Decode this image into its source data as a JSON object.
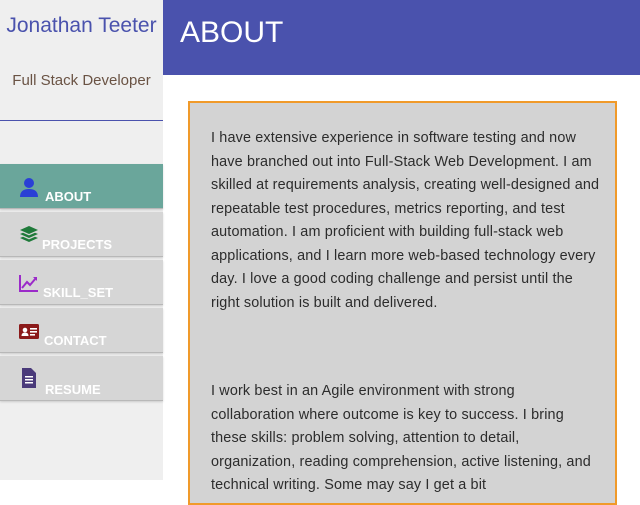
{
  "profile": {
    "name": "Jonathan Teeter",
    "title": "Full Stack Developer"
  },
  "nav": {
    "items": [
      {
        "label": "ABOUT",
        "icon": "user-icon",
        "active": true
      },
      {
        "label": "PROJECTS",
        "icon": "layers-icon",
        "active": false
      },
      {
        "label": "SKILL_SET",
        "icon": "chart-line-icon",
        "active": false
      },
      {
        "label": "CONTACT",
        "icon": "id-card-icon",
        "active": false
      },
      {
        "label": "RESUME",
        "icon": "document-icon",
        "active": false
      }
    ]
  },
  "header": {
    "title": "ABOUT"
  },
  "about": {
    "paragraphs": [
      "I have extensive experience in software testing and now have branched out into Full-Stack Web Development. I am skilled at requirements analysis, creating well-designed and repeatable test procedures, metrics reporting, and test automation. I am proficient with building full-stack web applications, and I learn more web-based technology every day. I love a good coding challenge and persist until the right solution is built and delivered.",
      "I work best in an Agile environment with strong collaboration where outcome is key to success. I bring these skills: problem solving, attention to detail, organization, reading comprehension, active listening, and technical writing. Some may say I get a bit"
    ]
  },
  "colors": {
    "brand": "#4a52ad",
    "active_nav": "#6aa69b",
    "card_border": "#f09a2a",
    "icon_user": "#2a3fd6",
    "icon_layers": "#1f7a3a",
    "icon_chart": "#9b2bc9",
    "icon_card": "#8b1a1a",
    "icon_doc": "#4a3a7a"
  }
}
